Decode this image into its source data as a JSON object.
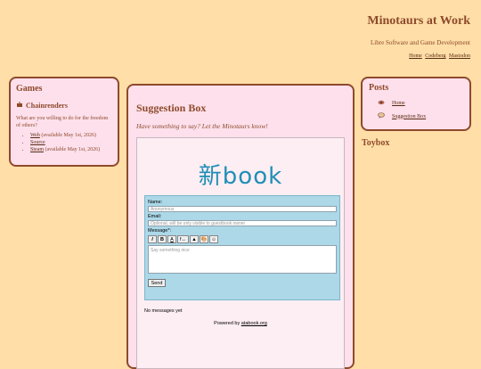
{
  "header": {
    "title": "Minotaurs at Work",
    "subtitle": "Libre Software and Game Development",
    "nav": [
      "Home",
      "Codeberg",
      "Mastodon"
    ]
  },
  "games": {
    "heading": "Games",
    "project": "Chainrenders",
    "question": "What are you willing to do for the freedom of others?",
    "links": [
      {
        "label": "Web",
        "note": " (available May 1st, 2026)"
      },
      {
        "label": "Source",
        "note": ""
      },
      {
        "label": "Steam",
        "note": " (available May 1st, 2026)"
      }
    ]
  },
  "posts": {
    "heading": "Posts",
    "items": [
      "Home",
      "Suggestion Box"
    ]
  },
  "toybox": "Toybox",
  "main": {
    "title": "Suggestion Box",
    "lead": "Have something to say? Let the Minotaurs know!"
  },
  "guestbook": {
    "logo": "新book",
    "name_label": "Name:",
    "name_placeholder": "Anonymous",
    "email_label": "Email:",
    "email_placeholder": "Optional, will be only visible to guestbook owner",
    "message_label": "Message*:",
    "toolbar": [
      "I",
      "B",
      "A",
      "f↔",
      "▲",
      "🎨",
      "☺"
    ],
    "message_placeholder": "Say something nice",
    "send_label": "Send",
    "empty_text": "No messages yet",
    "powered_prefix": "Powered by ",
    "powered_link": "atabook.org"
  },
  "colors": {
    "background": "#ffdea8",
    "panel": "#fde0ec",
    "border": "#8e4a2b",
    "form": "#acd8e8",
    "logo": "#1f8fb6"
  }
}
